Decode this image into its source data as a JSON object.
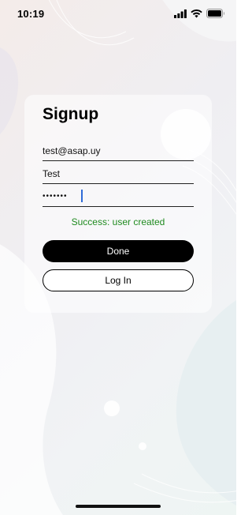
{
  "status_bar": {
    "time": "10:19",
    "icons": [
      "signal-icon",
      "wifi-icon",
      "battery-icon"
    ]
  },
  "signup": {
    "title": "Signup",
    "email_value": "test@asap.uy",
    "name_value": "Test",
    "password_masked": "•••••••",
    "status_message": "Success: user created",
    "done_label": "Done",
    "login_label": "Log In"
  },
  "colors": {
    "success": "#1f8a1f",
    "primary_button": "#000000",
    "caret": "#2f6bd8"
  }
}
